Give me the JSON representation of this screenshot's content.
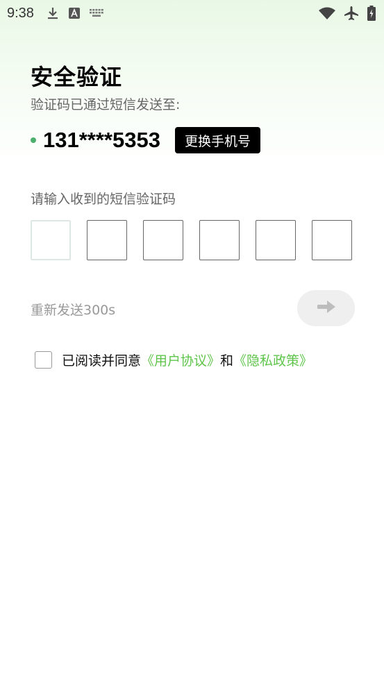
{
  "status_bar": {
    "time": "9:38",
    "left_icons": [
      "download-icon",
      "keyboard-a-icon",
      "keyboard-icon"
    ],
    "right_icons": [
      "wifi-icon",
      "airplane-icon",
      "battery-icon"
    ]
  },
  "page": {
    "title": "安全验证",
    "subtitle": "验证码已通过短信发送至:",
    "phone_number": "131****5353",
    "change_phone_label": "更换手机号",
    "code_label": "请输入收到的短信验证码",
    "code_digits": [
      "",
      "",
      "",
      "",
      "",
      ""
    ],
    "resend_text": "重新发送300s",
    "next_icon": "arrow-right-icon"
  },
  "agreement": {
    "checked": false,
    "prefix": "已阅读并同意",
    "user_agreement": "《用户协议》",
    "and": "和",
    "privacy_policy": "《隐私政策》"
  },
  "colors": {
    "accent": "#5ec54a",
    "dot": "#4caf6e",
    "button_bg": "#000000",
    "header_gradient": "#e9f8e6"
  }
}
